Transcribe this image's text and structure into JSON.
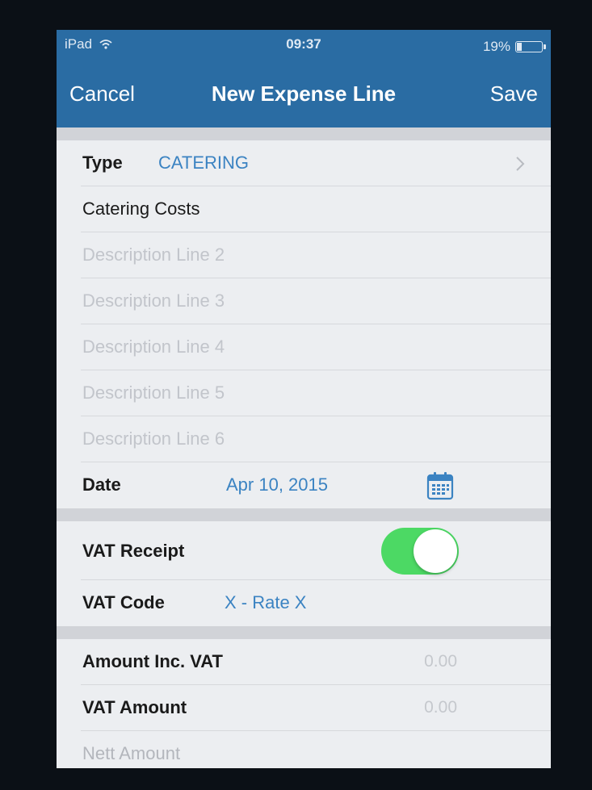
{
  "status_bar": {
    "device": "iPad",
    "time": "09:37",
    "battery": "19%",
    "battery_level": 0.19
  },
  "nav": {
    "cancel": "Cancel",
    "title": "New Expense Line",
    "save": "Save"
  },
  "form": {
    "type": {
      "label": "Type",
      "value": "CATERING"
    },
    "description_1": "Catering Costs",
    "description_placeholders": [
      "Description Line 2",
      "Description Line 3",
      "Description Line 4",
      "Description Line 5",
      "Description Line 6"
    ],
    "date": {
      "label": "Date",
      "value": "Apr 10, 2015",
      "icon": "calendar-icon"
    },
    "vat_receipt": {
      "label": "VAT Receipt",
      "on": true
    },
    "vat_code": {
      "label": "VAT Code",
      "value": "X - Rate X"
    },
    "amount_inc_vat": {
      "label": "Amount Inc. VAT",
      "value": "0.00"
    },
    "vat_amount": {
      "label": "VAT Amount",
      "value": "0.00"
    },
    "nett_amount": {
      "label": "Nett Amount"
    }
  },
  "colors": {
    "nav_bar": "#2a6ca3",
    "accent": "#3b83c2",
    "toggle_on": "#4cd964",
    "background": "#efeff4"
  }
}
